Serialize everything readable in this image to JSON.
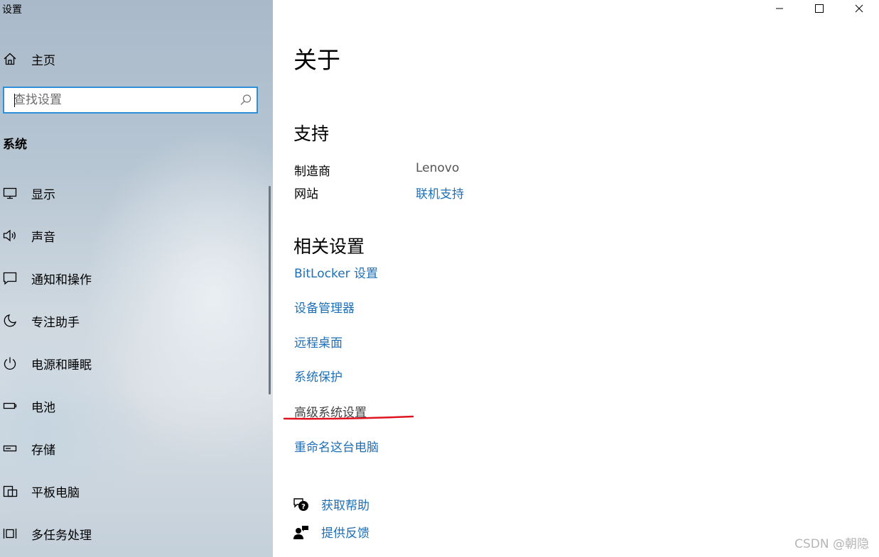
{
  "window": {
    "title": "设置",
    "controls": [
      "minimize",
      "maximize",
      "close"
    ]
  },
  "sidebar": {
    "home_label": "主页",
    "search_placeholder": "查找设置",
    "section_heading": "系统",
    "items": [
      {
        "label": "显示",
        "icon": "monitor-icon"
      },
      {
        "label": "声音",
        "icon": "speaker-icon"
      },
      {
        "label": "通知和操作",
        "icon": "notification-icon"
      },
      {
        "label": "专注助手",
        "icon": "moon-icon"
      },
      {
        "label": "电源和睡眠",
        "icon": "power-icon"
      },
      {
        "label": "电池",
        "icon": "battery-icon"
      },
      {
        "label": "存储",
        "icon": "storage-icon"
      },
      {
        "label": "平板电脑",
        "icon": "tablet-icon"
      },
      {
        "label": "多任务处理",
        "icon": "multitask-icon"
      }
    ]
  },
  "main": {
    "title": "关于",
    "support": {
      "heading": "支持",
      "manufacturer_label": "制造商",
      "manufacturer_value": "Lenovo",
      "website_label": "网站",
      "website_link": "联机支持"
    },
    "related": {
      "heading": "相关设置",
      "links": [
        "BitLocker 设置",
        "设备管理器",
        "远程桌面",
        "系统保护",
        "高级系统设置",
        "重命名这台电脑"
      ]
    },
    "help": {
      "get_help": "获取帮助",
      "feedback": "提供反馈"
    }
  },
  "watermark": "CSDN @朝隐",
  "colors": {
    "link": "#1e6fb6",
    "search_border": "#2f8fd8",
    "annotation": "#e0141e"
  }
}
